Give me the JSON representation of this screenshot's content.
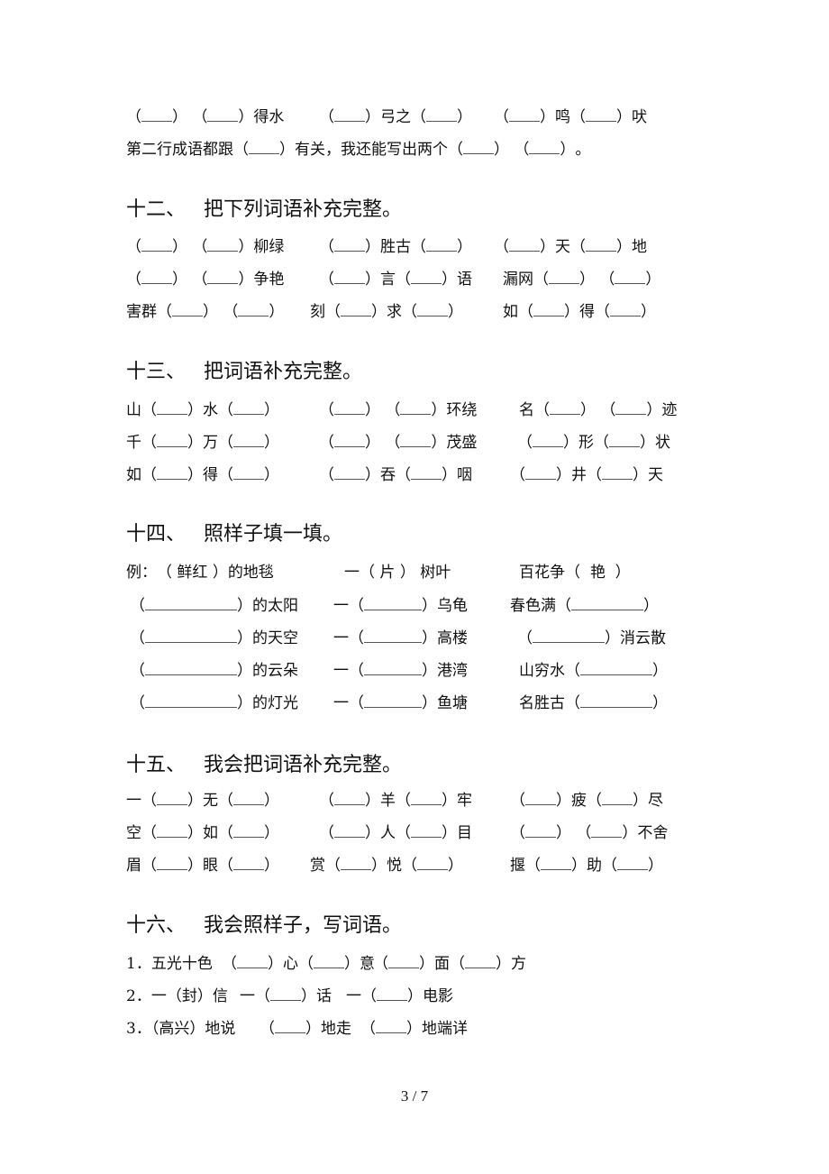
{
  "top_section": {
    "row1": {
      "item1": {
        "pre": "",
        "mid": "",
        "post": "得水"
      },
      "item2": {
        "pre": "",
        "mid": "弓之",
        "post": ""
      },
      "item3": {
        "pre": "",
        "mid": "鸣",
        "post": "吠"
      }
    },
    "row2": {
      "part1": "第二行成语都跟",
      "part2": "有关，我还能写出两个",
      "part3": "。"
    }
  },
  "section12": {
    "number": "十二、",
    "title": "把下列词语补充完整。",
    "rows": [
      [
        {
          "a": "",
          "b": "",
          "c": "柳绿"
        },
        {
          "a": "",
          "b": "胜古",
          "c": ""
        },
        {
          "a": "",
          "b": "天",
          "c": "地"
        }
      ],
      [
        {
          "a": "",
          "b": "",
          "c": "争艳"
        },
        {
          "a": "",
          "b": "言",
          "c": "语"
        },
        {
          "a": "漏网",
          "b": "",
          "c": ""
        }
      ],
      [
        {
          "a": "害群",
          "b": "",
          "c": ""
        },
        {
          "a": "刻",
          "b": "求",
          "c": ""
        },
        {
          "a": "如",
          "b": "得",
          "c": ""
        }
      ]
    ]
  },
  "section13": {
    "number": "十三、",
    "title": "把词语补充完整。",
    "rows": [
      [
        {
          "a": "山",
          "b": "水",
          "c": ""
        },
        {
          "a": "",
          "b": "",
          "c": "环绕"
        },
        {
          "a": "名",
          "b": "",
          "c": "迹"
        }
      ],
      [
        {
          "a": "千",
          "b": "万",
          "c": ""
        },
        {
          "a": "",
          "b": "",
          "c": "茂盛"
        },
        {
          "a": "",
          "b": "形",
          "c": "状"
        }
      ],
      [
        {
          "a": "如",
          "b": "得",
          "c": ""
        },
        {
          "a": "",
          "b": "吞",
          "c": "咽"
        },
        {
          "a": "",
          "b": "井",
          "c": "天"
        }
      ]
    ]
  },
  "section14": {
    "number": "十四、",
    "title": "照样子填一填。",
    "example": {
      "label": "例：",
      "col1_answer": "鲜红",
      "col1_suffix": "的地毯",
      "col2_prefix": "一",
      "col2_answer": "片",
      "col2_suffix": "树叶",
      "col3_prefix": "百花争",
      "col3_answer": "艳"
    },
    "rows": [
      {
        "col1_suffix": "的太阳",
        "col2_prefix": "一",
        "col2_suffix": "乌龟",
        "col3_prefix": "春色满",
        "col3_suffix": ""
      },
      {
        "col1_suffix": "的天空",
        "col2_prefix": "一",
        "col2_suffix": "高楼",
        "col3_prefix": "",
        "col3_suffix": "消云散"
      },
      {
        "col1_suffix": "的云朵",
        "col2_prefix": "一",
        "col2_suffix": "港湾",
        "col3_prefix": "山穷水",
        "col3_suffix": ""
      },
      {
        "col1_suffix": "的灯光",
        "col2_prefix": "一",
        "col2_suffix": "鱼塘",
        "col3_prefix": "名胜古",
        "col3_suffix": ""
      }
    ]
  },
  "section15": {
    "number": "十五、",
    "title": "我会把词语补充完整。",
    "rows": [
      [
        {
          "a": "一",
          "b": "无",
          "c": ""
        },
        {
          "a": "",
          "b": "羊",
          "c": "牢"
        },
        {
          "a": "",
          "b": "疲",
          "c": "尽"
        }
      ],
      [
        {
          "a": "空",
          "b": "如",
          "c": ""
        },
        {
          "a": "",
          "b": "人",
          "c": "目"
        },
        {
          "a": "",
          "b": "",
          "c": "不舍"
        }
      ],
      [
        {
          "a": "眉",
          "b": "眼",
          "c": ""
        },
        {
          "a": "赏",
          "b": "悦",
          "c": ""
        },
        {
          "a": "揠",
          "b": "助",
          "c": ""
        }
      ]
    ]
  },
  "section16": {
    "number": "十六、",
    "title": "我会照样子，写词语。",
    "items": [
      {
        "label": "1．五光十色",
        "q1_a": "",
        "q1_b": "心",
        "q1_c": "意",
        "q2_a": "",
        "q2_b": "面",
        "q2_c": "方"
      },
      {
        "label": "2．一（封）信",
        "q1_pre": "一",
        "q1_post": "话",
        "q2_pre": "一",
        "q2_post": "电影"
      },
      {
        "label": "3．（高兴）地说",
        "q1_post": "地走",
        "q2_post": "地端详"
      }
    ]
  },
  "footer": {
    "page_indicator": "3 / 7"
  }
}
